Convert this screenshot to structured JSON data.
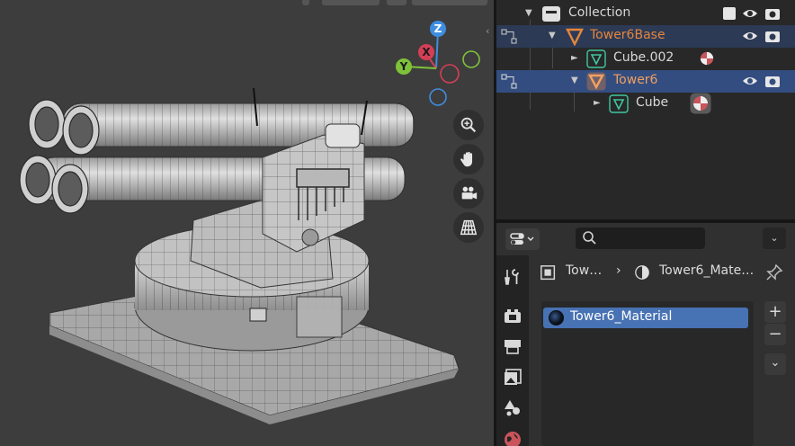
{
  "outliner": {
    "rows": [
      {
        "label": "Collection",
        "type": "collection"
      },
      {
        "label": "Tower6Base",
        "type": "object",
        "color": "#e5853d"
      },
      {
        "label": "Cube.002",
        "type": "mesh"
      },
      {
        "label": "Tower6",
        "type": "object",
        "color": "#e5853d"
      },
      {
        "label": "Cube",
        "type": "mesh"
      }
    ]
  },
  "properties": {
    "breadcrumb": {
      "object": "Tow…",
      "separator": "›",
      "material": "Tower6_Mate…"
    },
    "material_slots": [
      {
        "name": "Tower6_Material"
      }
    ],
    "buttons": {
      "add": "+",
      "remove": "−",
      "more": "⌄"
    }
  },
  "viewport": {
    "gizmo": {
      "x_label": "X",
      "y_label": "Y",
      "z_label": "Z"
    },
    "nav_tools": [
      "zoom-icon",
      "hand-pan-icon",
      "camera-view-icon",
      "grid-projection-icon"
    ]
  },
  "colors": {
    "accent": "#4772b3",
    "object_orange": "#e5853d",
    "mesh_green": "#3fc7a0",
    "axis_x": "#d43f55",
    "axis_y": "#7fc23a",
    "axis_z": "#3e8de0"
  }
}
